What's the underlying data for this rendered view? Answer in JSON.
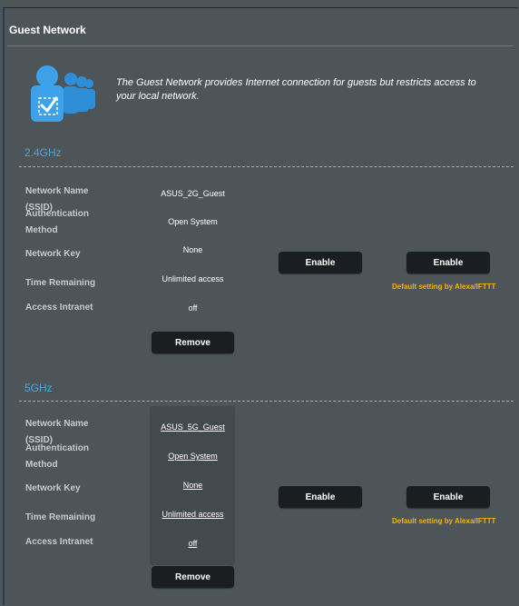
{
  "page": {
    "title": "Guest Network",
    "description": "The Guest Network provides Internet connection for guests but restricts access to your local network.",
    "hero_icon": "guest-users-icon"
  },
  "labels": {
    "ssid": "Network Name (SSID)",
    "auth_line1": "Authentication",
    "auth_line2": "Method",
    "key": "Network Key",
    "time": "Time Remaining",
    "intranet": "Access Intranet"
  },
  "band_24": {
    "name": "2.4GHz",
    "ssid": "ASUS_2G_Guest",
    "auth": "Open System",
    "key": "None",
    "time": "Unlimited access",
    "intranet": "off",
    "remove_label": "Remove",
    "enable_label": "Enable",
    "enable_alexa_label": "Enable",
    "alexa_note": "Default setting by Alexa/IFTTT"
  },
  "band_5": {
    "name": "5GHz",
    "ssid": "ASUS_5G_Guest",
    "auth": "Open System",
    "key": "None",
    "time": "Unlimited access",
    "intranet": "off",
    "remove_label": "Remove",
    "enable_label": "Enable",
    "enable_alexa_label": "Enable",
    "alexa_note": "Default setting by Alexa/IFTTT"
  },
  "colors": {
    "background": "#4d5559",
    "band_heading": "#4aa7e2",
    "button": "#1b1e20",
    "note": "#f5b400"
  }
}
